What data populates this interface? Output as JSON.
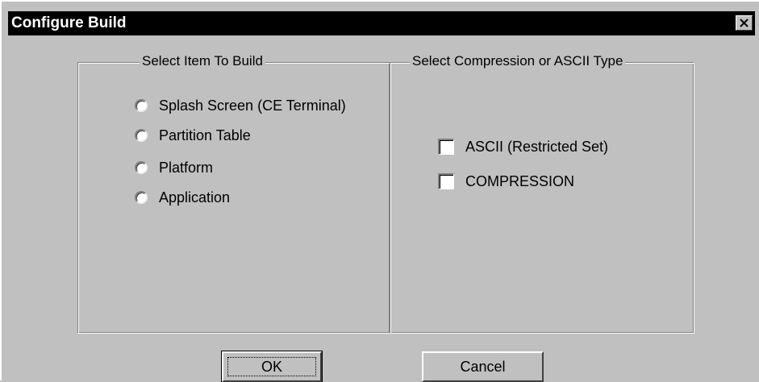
{
  "window": {
    "title": "Configure Build",
    "close_symbol": "×"
  },
  "build_group": {
    "legend": "Select Item To Build",
    "options": [
      {
        "label": "Splash Screen (CE Terminal)",
        "selected": false
      },
      {
        "label": "Partition Table",
        "selected": false
      },
      {
        "label": "Platform",
        "selected": false
      },
      {
        "label": "Application",
        "selected": false
      }
    ]
  },
  "type_group": {
    "legend": "Select Compression or ASCII Type",
    "options": [
      {
        "label": "ASCII (Restricted Set)",
        "checked": false
      },
      {
        "label": "COMPRESSION",
        "checked": false
      }
    ]
  },
  "buttons": {
    "ok_label": "OK",
    "cancel_label": "Cancel"
  },
  "colors": {
    "face": "#c0c0c0",
    "titlebar": "#000000",
    "title_text": "#ffffff"
  },
  "icons": {
    "close": "close-icon"
  }
}
